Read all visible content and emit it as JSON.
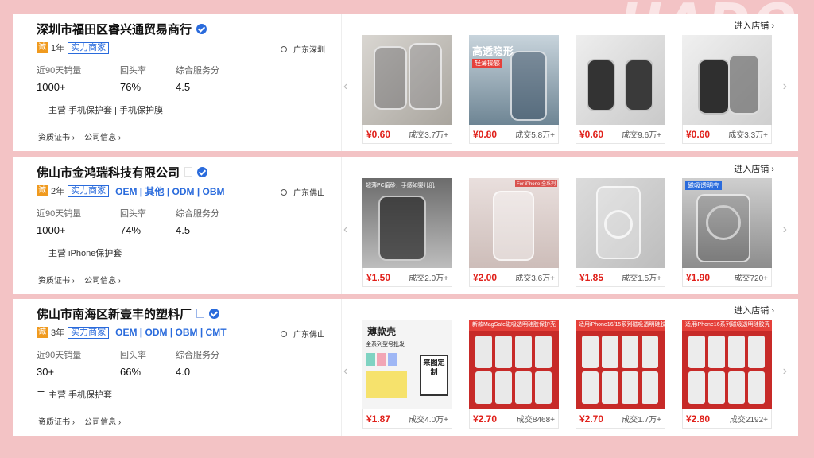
{
  "suppliers": [
    {
      "name": "深圳市福田区睿兴通贸易商行",
      "cheng": "诚",
      "years": "1年",
      "badge": "实力商家",
      "extra_tags": "",
      "location": "广东深圳",
      "stats_labels": [
        "近90天销量",
        "回头率",
        "综合服务分"
      ],
      "stats_values": [
        "1000+",
        "76%",
        "4.5"
      ],
      "main_business": "主营  手机保护套 | 手机保护膜",
      "links": [
        "资质证书 ›",
        "公司信息 ›"
      ],
      "enter_label": "进入店铺 ›",
      "products": [
        {
          "price": "¥0.60",
          "deal": "成交3.7万+"
        },
        {
          "price": "¥0.80",
          "deal": "成交5.8万+"
        },
        {
          "price": "¥0.60",
          "deal": "成交9.6万+"
        },
        {
          "price": "¥0.60",
          "deal": "成交3.3万+"
        }
      ]
    },
    {
      "name": "佛山市金鸿瑞科技有限公司",
      "cheng": "诚",
      "years": "2年",
      "badge": "实力商家",
      "extra_tags": "OEM | 其他 | ODM | OBM",
      "location": "广东佛山",
      "stats_labels": [
        "近90天销量",
        "回头率",
        "综合服务分"
      ],
      "stats_values": [
        "1000+",
        "74%",
        "4.5"
      ],
      "main_business": "主营  iPhone保护套",
      "links": [
        "资质证书 ›",
        "公司信息 ›"
      ],
      "enter_label": "进入店铺 ›",
      "products": [
        {
          "price": "¥1.50",
          "deal": "成交2.0万+"
        },
        {
          "price": "¥2.00",
          "deal": "成交3.6万+"
        },
        {
          "price": "¥1.85",
          "deal": "成交1.5万+"
        },
        {
          "price": "¥1.90",
          "deal": "成交720+"
        }
      ]
    },
    {
      "name": "佛山市南海区新壹丰的塑料厂",
      "cheng": "诚",
      "years": "3年",
      "badge": "实力商家",
      "extra_tags": "OEM | ODM | OBM | CMT",
      "location": "广东佛山",
      "stats_labels": [
        "近90天销量",
        "回头率",
        "综合服务分"
      ],
      "stats_values": [
        "30+",
        "66%",
        "4.0"
      ],
      "main_business": "主营  手机保护套",
      "links": [
        "资质证书 ›",
        "公司信息 ›"
      ],
      "enter_label": "进入店铺 ›",
      "products": [
        {
          "price": "¥1.87",
          "deal": "成交4.0万+"
        },
        {
          "price": "¥2.70",
          "deal": "成交8468+"
        },
        {
          "price": "¥2.70",
          "deal": "成交1.7万+"
        },
        {
          "price": "¥2.80",
          "deal": "成交2192+"
        }
      ]
    }
  ],
  "image_texts": {
    "p1_2": "高透隐形",
    "p1_2b": "轻薄操感",
    "p2_1": "超薄PC磨砂，手感如婴儿肌",
    "p2_2": "For iPhone 全系列",
    "p2_4": "磁吸透明壳",
    "p3_1a": "薄款壳",
    "p3_1b": "全系列型号批发",
    "p3_1c": "来图定制",
    "p3_2": "新款MagSafe磁吸透明硅胶保护壳",
    "p3_3": "适用iPhone16/15系列磁吸透明硅胶壳",
    "p3_4": "适用iPhone16系列磁吸透明硅胶壳"
  },
  "watermark": "HADO",
  "colors": {
    "accent_blue": "#2a6bdc",
    "price_red": "#e0201a",
    "cheng_orange": "#f09a1e",
    "background": "#f3c3c5"
  }
}
